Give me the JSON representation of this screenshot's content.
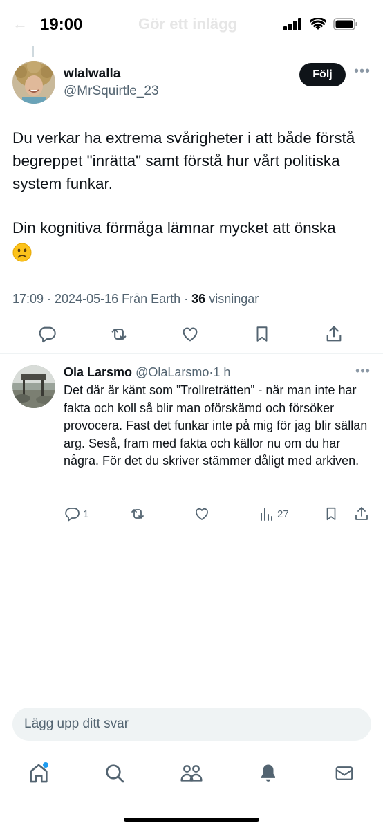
{
  "status_bar": {
    "time": "19:00"
  },
  "header": {
    "back_icon": "arrow-left-icon",
    "title": "Gör ett inlägg"
  },
  "tweet": {
    "author_name": "wlalwalla",
    "author_handle": "@MrSquirtle_23",
    "follow_label": "Följ",
    "text_para1": "Du verkar ha extrema svårigheter i att både förstå begreppet \"inrätta\" samt förstå hur vårt politiska system funkar.",
    "text_para2": "Din kognitiva förmåga lämnar mycket att önska",
    "emoji": "slightly-frowning-face",
    "timestamp": "17:09 · 2024-05-16 Från Earth · ",
    "views_count": "36",
    "views_label": " visningar"
  },
  "reply": {
    "name": "Ola Larsmo",
    "handle": "@OlaLarsmo",
    "separator": "·",
    "time": "1 h",
    "text": "Det där är känt som ”Trollreträtten” - när man inte har fakta och koll så blir man oförskämd och försöker provocera. Fast det funkar inte på mig för jag blir sällan arg. Seså, fram med fakta och källor nu om du har några. För det du skriver stämmer dåligt med arkiven.",
    "reply_count": "1",
    "views_count": "27"
  },
  "composer": {
    "placeholder": "Lägg upp ditt svar"
  },
  "tabbar": {
    "items": [
      "home-icon",
      "search-icon",
      "communities-icon",
      "bell-icon",
      "mail-icon"
    ]
  },
  "colors": {
    "text": "#0f1419",
    "secondary": "#536471",
    "accent": "#1d9bf0",
    "follow_bg": "#0f1419"
  }
}
